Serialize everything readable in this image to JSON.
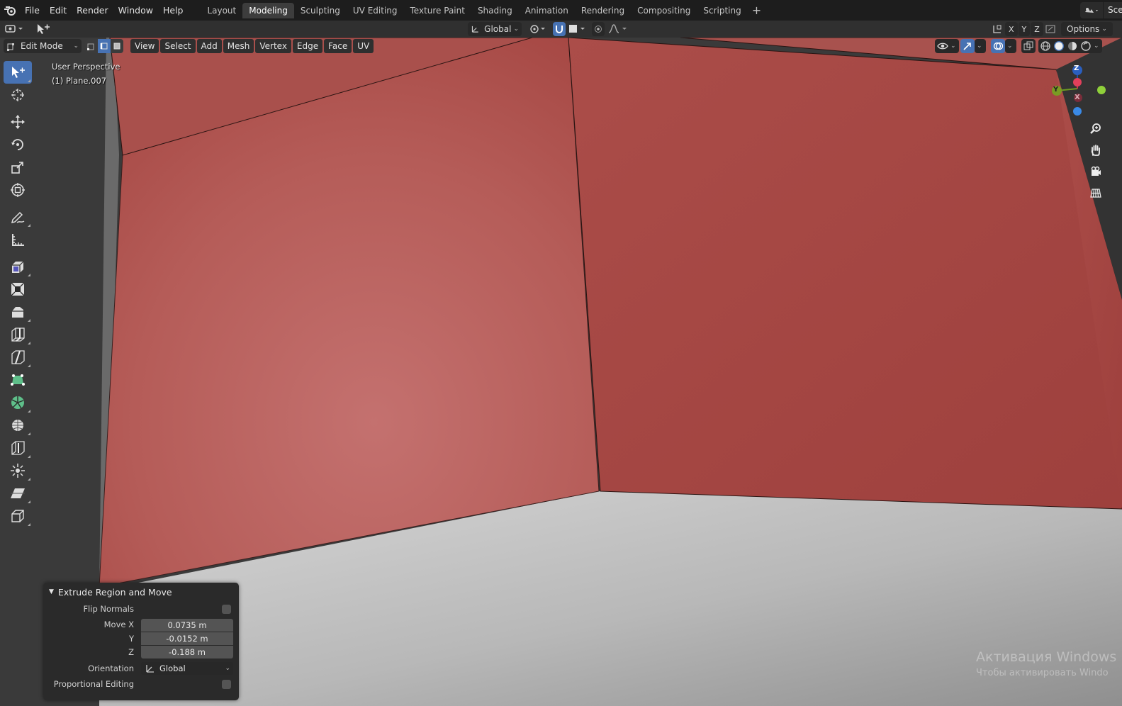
{
  "menu": {
    "file": "File",
    "edit": "Edit",
    "render": "Render",
    "window": "Window",
    "help": "Help"
  },
  "workspaces": [
    "Layout",
    "Modeling",
    "Sculpting",
    "UV Editing",
    "Texture Paint",
    "Shading",
    "Animation",
    "Rendering",
    "Compositing",
    "Scripting"
  ],
  "workspace_add": "+",
  "scene": {
    "name": "Scene"
  },
  "tool_header": {
    "orientation": "Global",
    "axes": [
      "X",
      "Y",
      "Z"
    ],
    "options": "Options"
  },
  "viewport_header": {
    "mode": "Edit Mode",
    "menus": [
      "View",
      "Select",
      "Add",
      "Mesh",
      "Vertex",
      "Edge",
      "Face",
      "UV"
    ]
  },
  "viewport": {
    "perspective": "User Perspective",
    "object": "(1) Plane.007"
  },
  "gizmo": {
    "z": "Z",
    "y": "Y",
    "x": "X"
  },
  "operator_panel": {
    "title": "Extrude Region and Move",
    "flip_normals_label": "Flip Normals",
    "flip_normals": false,
    "move_x_label": "Move X",
    "move_x": "0.0735 m",
    "y_label": "Y",
    "y": "-0.0152 m",
    "z_label": "Z",
    "z": "-0.188 m",
    "orientation_label": "Orientation",
    "orientation": "Global",
    "proportional_label": "Proportional Editing",
    "proportional": false
  },
  "watermark": {
    "line1": "Активация Windows",
    "line2": "Чтобы активировать Windo"
  },
  "colors": {
    "accent": "#4772b3",
    "mesh": "#b45a55",
    "background": "#1d1d1d"
  }
}
